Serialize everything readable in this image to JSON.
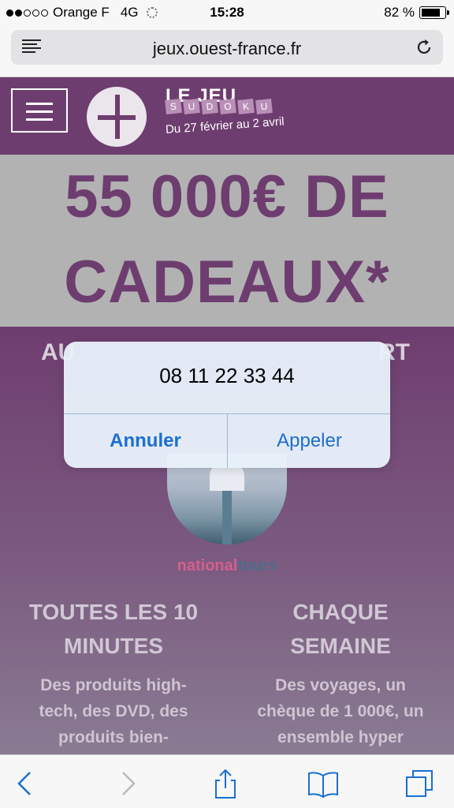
{
  "status_bar": {
    "carrier": "Orange F",
    "network": "4G",
    "time": "15:28",
    "battery": "82 %"
  },
  "url_bar": {
    "url": "jeux.ouest-france.fr"
  },
  "site_header": {
    "game_title": "LE JEU",
    "game_name_letters": [
      "S",
      "U",
      "D",
      "O",
      "K",
      "U"
    ],
    "dates": "Du 27 février au 2 avril"
  },
  "banner": {
    "line1": "55 000€ DE",
    "line2": "CADEAUX*"
  },
  "content": {
    "partial_left": "AU",
    "partial_right": "RT",
    "sponsor_part1": "national",
    "sponsor_part2": "tours",
    "col_left_title": "TOUTES LES 10 MINUTES",
    "col_left_text": "Des produits high-tech, des DVD, des produits bien-",
    "col_right_title": "CHAQUE SEMAINE",
    "col_right_text": "Des voyages, un chèque de 1 000€, un ensemble hyper"
  },
  "alert": {
    "phone_number": "08 11 22 33 44",
    "cancel_label": "Annuler",
    "call_label": "Appeler"
  },
  "colors": {
    "brand_purple": "#6e3d6f",
    "ios_blue": "#1a6fd2"
  }
}
